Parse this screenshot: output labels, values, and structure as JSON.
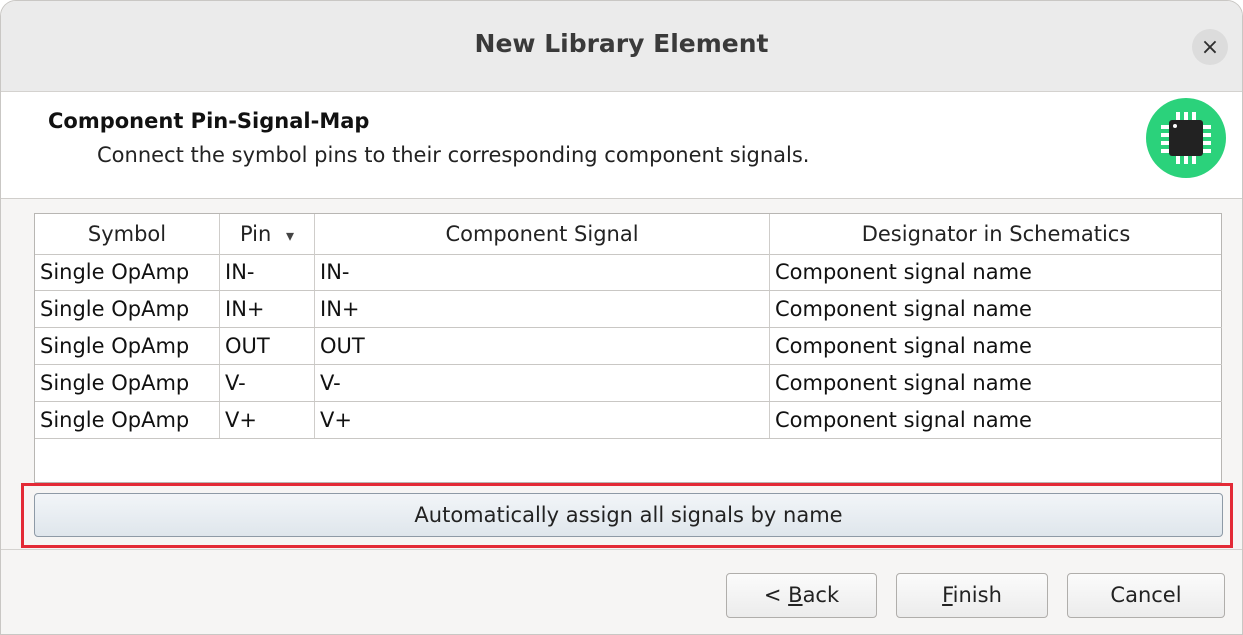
{
  "window": {
    "title": "New Library Element",
    "close_glyph": "×"
  },
  "header": {
    "title": "Component Pin-Signal-Map",
    "subtitle": "Connect the symbol pins to their corresponding component signals.",
    "icon": "chip-icon",
    "icon_color": "#2bd27b"
  },
  "table": {
    "columns": [
      "Symbol",
      "Pin",
      "Component Signal",
      "Designator in Schematics"
    ],
    "sort_indicator": "▾",
    "rows": [
      {
        "symbol": "Single OpAmp",
        "pin": "IN-",
        "signal": "IN-",
        "designator": "Component signal name"
      },
      {
        "symbol": "Single OpAmp",
        "pin": "IN+",
        "signal": "IN+",
        "designator": "Component signal name"
      },
      {
        "symbol": "Single OpAmp",
        "pin": "OUT",
        "signal": "OUT",
        "designator": "Component signal name"
      },
      {
        "symbol": "Single OpAmp",
        "pin": "V-",
        "signal": "V-",
        "designator": "Component signal name"
      },
      {
        "symbol": "Single OpAmp",
        "pin": "V+",
        "signal": "V+",
        "designator": "Component signal name"
      }
    ]
  },
  "auto_assign_label": "Automatically assign all signals by name",
  "highlight_color": "#e32a36",
  "footer": {
    "back_prefix": "< ",
    "back_mnemonic": "B",
    "back_rest": "ack",
    "finish_mnemonic": "F",
    "finish_rest": "inish",
    "cancel_label": "Cancel"
  }
}
